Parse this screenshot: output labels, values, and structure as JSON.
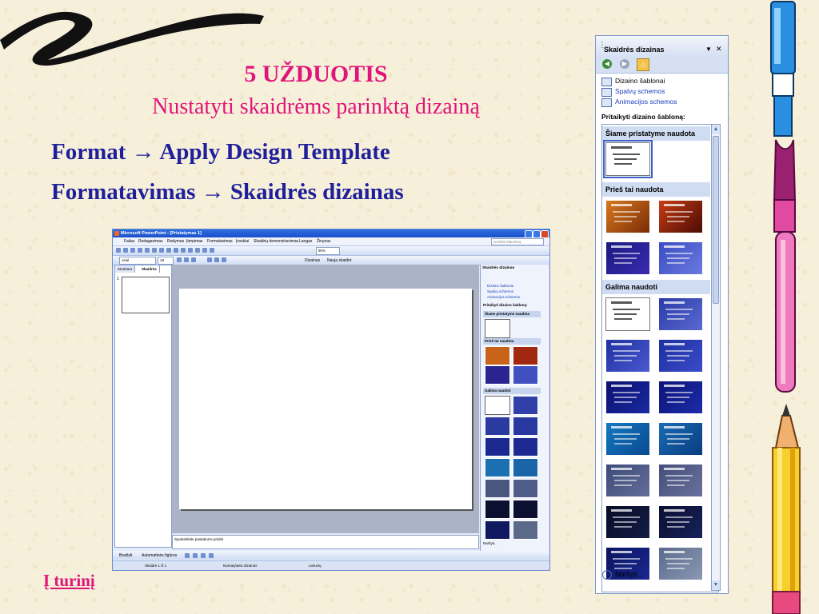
{
  "slide": {
    "number_title": "5 UŽDUOTIS",
    "subtitle": "Nustatyti skaidrėms parinktą dizainą",
    "line1_left": "Format",
    "line1_right": "Apply Design Template",
    "line2_left": "Formatavimas",
    "line2_right": "Skaidrės dizainas",
    "arrow": "→",
    "link": "Į turinį"
  },
  "screenshot": {
    "window_title": "Microsoft PowerPoint - [Pristatymas 1]",
    "menu": [
      "Failas",
      "Redagavimas",
      "Rodymas",
      "Įterpimas",
      "Formatavimas",
      "Įrankiai",
      "Skaidrių demonstravimas",
      "Langas",
      "Žinynas"
    ],
    "help_placeholder": "Įveskite klausimą",
    "zoom": "90%",
    "font": "Arial",
    "font_size": "18",
    "design_button": "Dizainas",
    "new_slide_button": "Nauja skaidrė",
    "tab_outline": "Struktūra",
    "tab_slides": "Skaidrės",
    "slide_num": "1",
    "notes_placeholder": "Spustelėkite pastaboms pridėti",
    "drawing_label": "Braižyti",
    "autoshapes_label": "Automatinės figūros",
    "status_slide": "Skaidrė 1 iš 1",
    "status_design": "Numatytasis dizainas",
    "status_lang": "Lietuvių"
  },
  "task_pane": {
    "title": "Skaidrės dizainas",
    "links": [
      "Dizaino šablonai",
      "Spalvų schemos",
      "Animacijos schemos"
    ],
    "subheading": "Pritaikyti dizaino šabloną:",
    "section_current": "Šiame pristatyme naudota",
    "section_recent": "Prieš tai naudota",
    "section_available": "Galima naudoti",
    "browse": "Naršyti..."
  },
  "colors": {
    "heading_pink": "#e0157a",
    "heading_blue": "#1f1f9b",
    "background": "#f6efd9"
  }
}
